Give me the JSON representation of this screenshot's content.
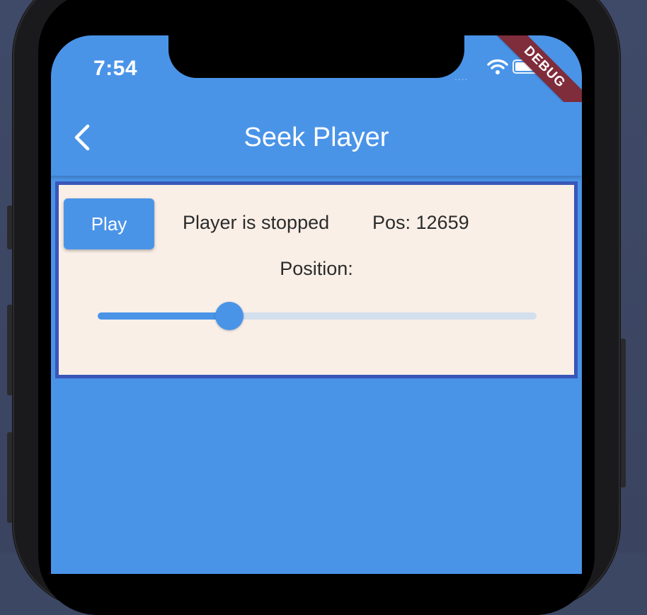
{
  "status_bar": {
    "time": "7:54",
    "signal_dots": "....",
    "wifi_icon": "wifi-icon",
    "battery_icon": "battery-icon"
  },
  "debug_banner": {
    "label": "DEBUG"
  },
  "app_bar": {
    "title": "Seek Player",
    "back_icon": "chevron-left-icon"
  },
  "player": {
    "play_label": "Play",
    "status_text": "Player is stopped",
    "position_text": "Pos: 12659",
    "position_label": "Position:",
    "slider_value_fraction": 0.3
  },
  "colors": {
    "primary": "#4a94e8",
    "card_background": "#f9efe7",
    "card_border": "#3a56b8",
    "debug_ribbon": "#7f2c3b"
  }
}
